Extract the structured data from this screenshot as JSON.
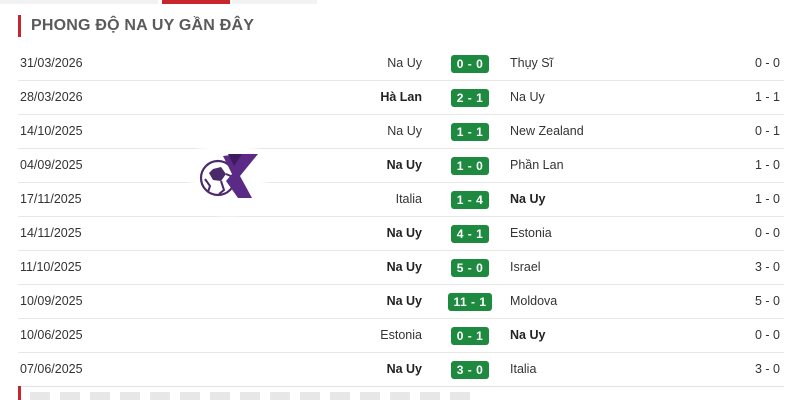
{
  "section": {
    "title": "PHONG ĐỘ NA UY GẦN ĐÂY"
  },
  "matches": [
    {
      "date": "31/03/2026",
      "home": "Na Uy",
      "score": "0 - 0",
      "away": "Thụy Sĩ",
      "ht": "0 - 0",
      "bold": "none"
    },
    {
      "date": "28/03/2026",
      "home": "Hà Lan",
      "score": "2 - 1",
      "away": "Na Uy",
      "ht": "1 - 1",
      "bold": "home"
    },
    {
      "date": "14/10/2025",
      "home": "Na Uy",
      "score": "1 - 1",
      "away": "New Zealand",
      "ht": "0 - 1",
      "bold": "none"
    },
    {
      "date": "04/09/2025",
      "home": "Na Uy",
      "score": "1 - 0",
      "away": "Phần Lan",
      "ht": "1 - 0",
      "bold": "home"
    },
    {
      "date": "17/11/2025",
      "home": "Italia",
      "score": "1 - 4",
      "away": "Na Uy",
      "ht": "1 - 0",
      "bold": "away"
    },
    {
      "date": "14/11/2025",
      "home": "Na Uy",
      "score": "4 - 1",
      "away": "Estonia",
      "ht": "0 - 0",
      "bold": "home"
    },
    {
      "date": "11/10/2025",
      "home": "Na Uy",
      "score": "5 - 0",
      "away": "Israel",
      "ht": "3 - 0",
      "bold": "home"
    },
    {
      "date": "10/09/2025",
      "home": "Na Uy",
      "score": "11 - 1",
      "away": "Moldova",
      "ht": "5 - 0",
      "bold": "home"
    },
    {
      "date": "10/06/2025",
      "home": "Estonia",
      "score": "0 - 1",
      "away": "Na Uy",
      "ht": "0 - 0",
      "bold": "away"
    },
    {
      "date": "07/06/2025",
      "home": "Na Uy",
      "score": "3 - 0",
      "away": "Italia",
      "ht": "3 - 0",
      "bold": "home"
    }
  ],
  "colors": {
    "accent": "#c9252c",
    "score_badge": "#1d8a3f",
    "logo_purple": "#5b2a86"
  },
  "icons": {
    "watermark": "soccer-ball-k-logo"
  }
}
